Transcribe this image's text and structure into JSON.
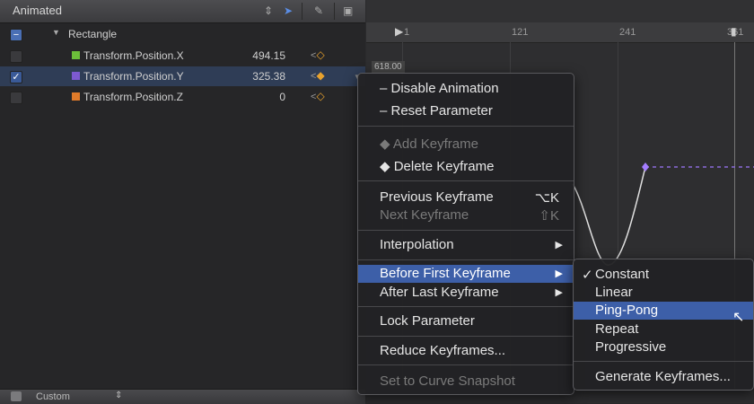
{
  "header": {
    "title": "Animated",
    "icons": [
      "stepper-icon",
      "arrow-tool-icon",
      "pen-tool-icon",
      "frame-tool-icon"
    ]
  },
  "rows": [
    {
      "name": "Rectangle",
      "value": "",
      "color": ""
    },
    {
      "name": "Transform.Position.X",
      "value": "494.15",
      "color": "#6cbf3a"
    },
    {
      "name": "Transform.Position.Y",
      "value": "325.38",
      "color": "#7d5ad1"
    },
    {
      "name": "Transform.Position.Z",
      "value": "0",
      "color": "#e07b2a"
    }
  ],
  "footer": {
    "label": "Custom"
  },
  "ruler": {
    "ticks": [
      "1",
      "121",
      "241",
      "361"
    ],
    "value_label": "618.00"
  },
  "menu": {
    "items": [
      {
        "label": "– Disable Animation",
        "shortcut": "",
        "disabled": false
      },
      {
        "label": "– Reset Parameter",
        "shortcut": "",
        "disabled": false
      },
      {
        "label": "◆ Add Keyframe",
        "shortcut": "",
        "disabled": true
      },
      {
        "label": "◆ Delete Keyframe",
        "shortcut": "",
        "disabled": false
      },
      {
        "label": "Previous Keyframe",
        "shortcut": "⌥K",
        "disabled": false
      },
      {
        "label": "Next Keyframe",
        "shortcut": "⇧K",
        "disabled": true
      },
      {
        "label": "Interpolation",
        "shortcut": "",
        "disabled": false
      },
      {
        "label": "Before First Keyframe",
        "shortcut": "",
        "disabled": false
      },
      {
        "label": "After Last Keyframe",
        "shortcut": "",
        "disabled": false
      },
      {
        "label": "Lock Parameter",
        "shortcut": "",
        "disabled": false
      },
      {
        "label": "Reduce Keyframes...",
        "shortcut": "",
        "disabled": false
      },
      {
        "label": "Set to Curve Snapshot",
        "shortcut": "",
        "disabled": true
      }
    ]
  },
  "submenu": {
    "items": [
      {
        "label": "Constant",
        "checked": true
      },
      {
        "label": "Linear",
        "checked": false
      },
      {
        "label": "Ping-Pong",
        "checked": false
      },
      {
        "label": "Repeat",
        "checked": false
      },
      {
        "label": "Progressive",
        "checked": false
      },
      {
        "label": "Generate Keyframes...",
        "checked": false
      }
    ]
  },
  "colors": {
    "accent": "#3d5fa8",
    "selection": "#2f3d56",
    "keyframe": "#e8a22e"
  }
}
